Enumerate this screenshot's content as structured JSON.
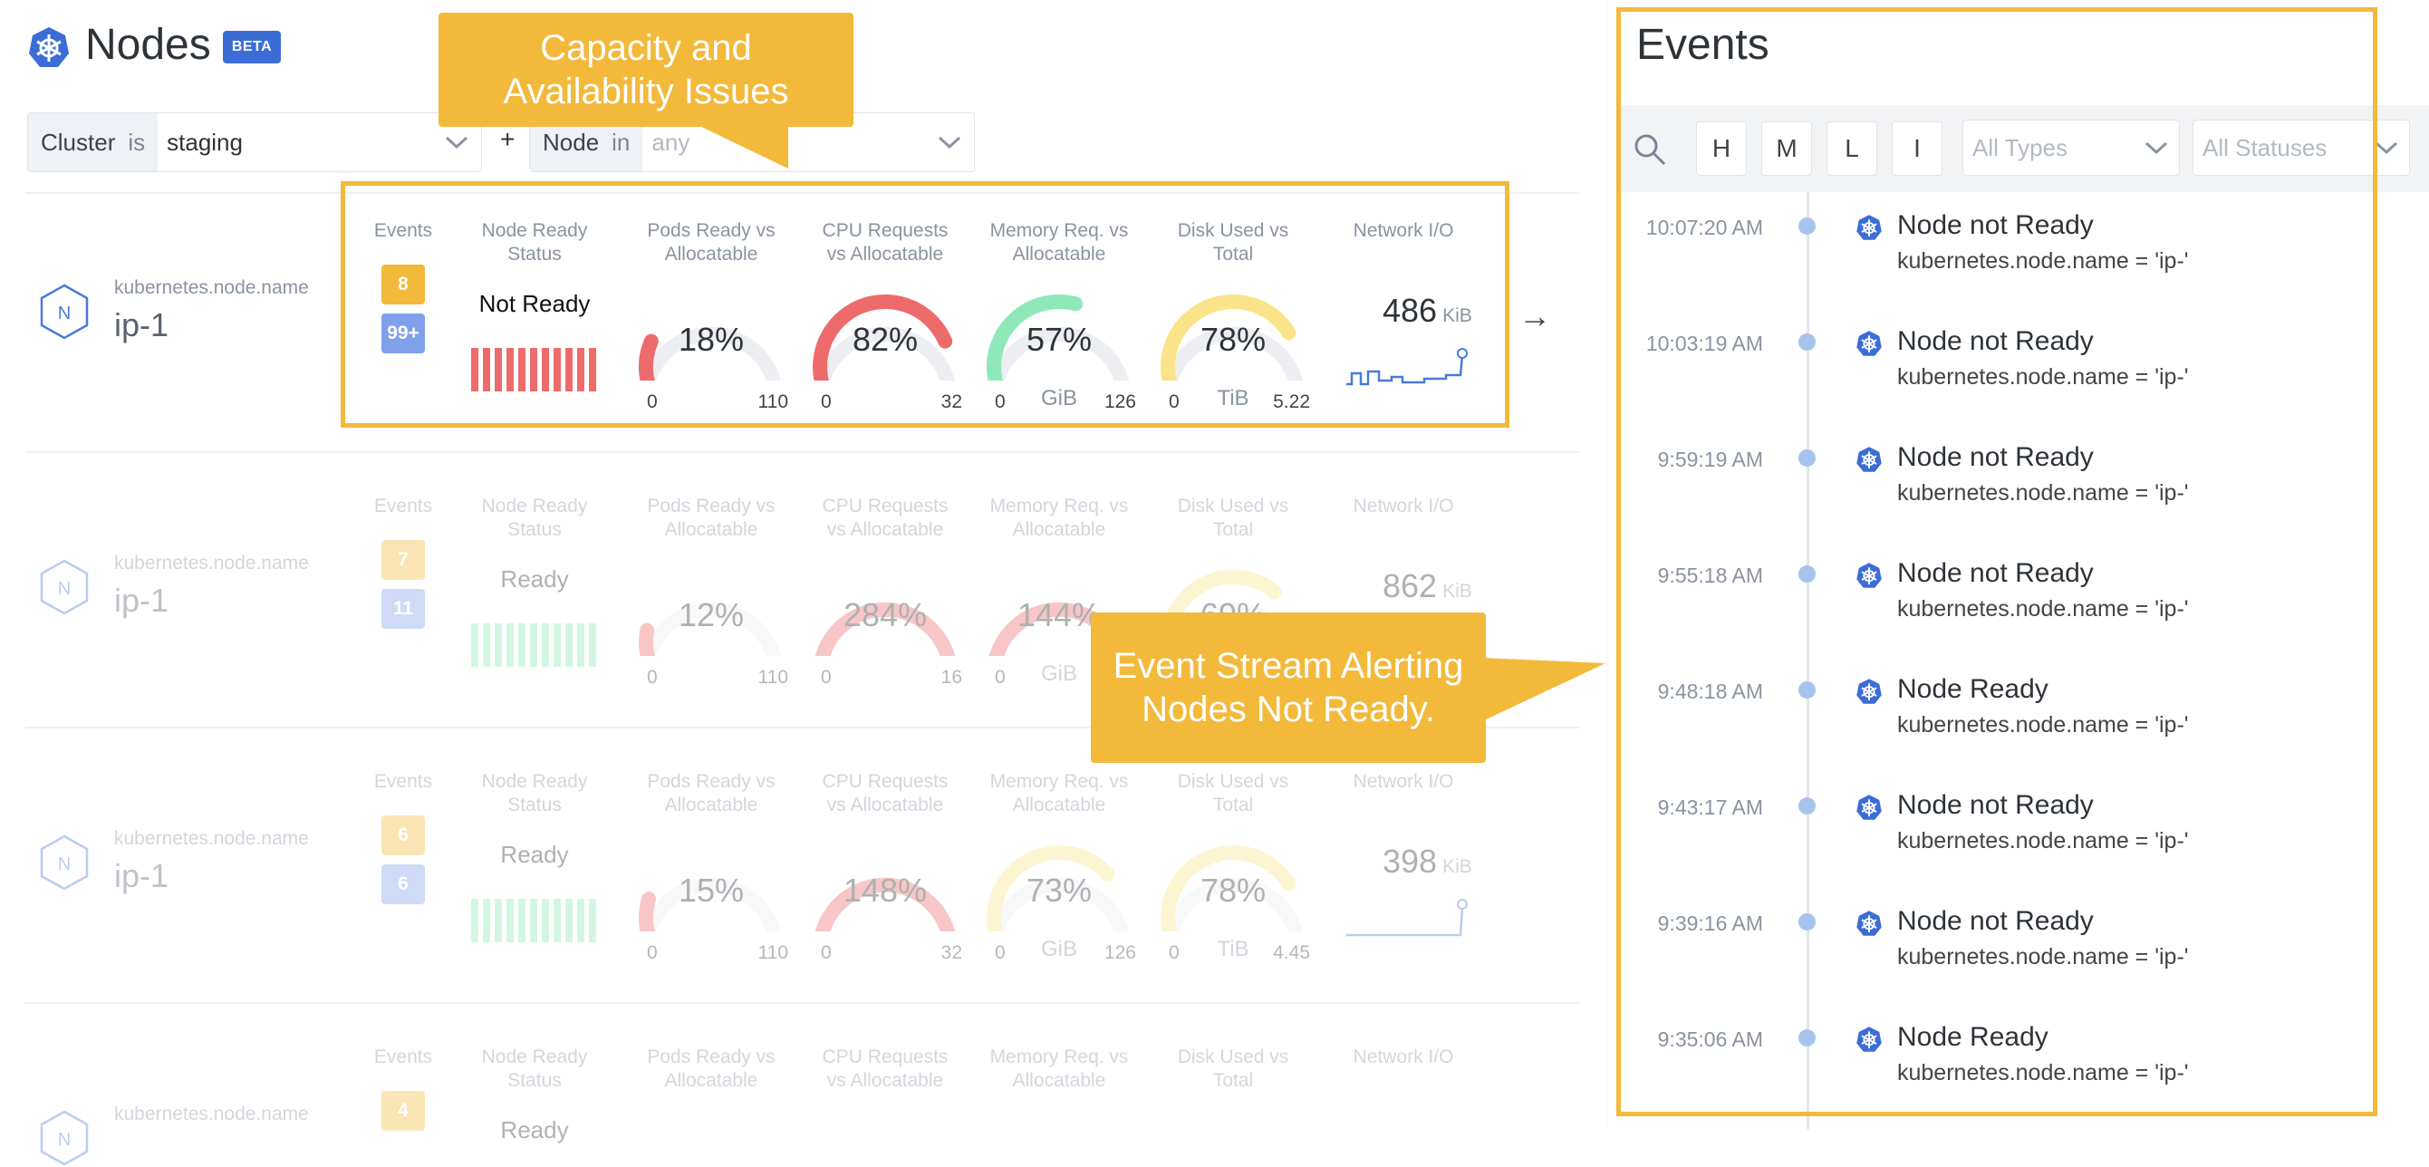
{
  "header": {
    "title": "Nodes",
    "badge": "BETA"
  },
  "filters": [
    {
      "key": "Cluster",
      "op": "is",
      "value": "staging"
    },
    {
      "key": "Node",
      "op": "in",
      "value": "any"
    }
  ],
  "filter_add": "+",
  "columns": [
    "Events",
    "Node Ready\nStatus",
    "Pods Ready vs\nAllocatable",
    "CPU Requests\nvs Allocatable",
    "Memory Req. vs\nAllocatable",
    "Disk Used vs\nTotal",
    "Network I/O"
  ],
  "nodes": [
    {
      "key": "kubernetes.node.name",
      "name": "ip-1",
      "events_a": "8",
      "events_b": "99+",
      "status": "Not Ready",
      "pods": {
        "pct": "18%",
        "min": "0",
        "max": "110",
        "frac": 0.18
      },
      "cpu": {
        "pct": "82%",
        "min": "0",
        "max": "32",
        "frac": 0.82
      },
      "mem": {
        "pct": "57%",
        "min": "0",
        "unit": "GiB",
        "max": "126",
        "frac": 0.57
      },
      "disk": {
        "pct": "78%",
        "min": "0",
        "unit": "TiB",
        "max": "5.22",
        "frac": 0.78
      },
      "net": {
        "value": "486",
        "unit": "KiB"
      }
    },
    {
      "key": "kubernetes.node.name",
      "name": "ip-1",
      "events_a": "7",
      "events_b": "11",
      "status": "Ready",
      "pods": {
        "pct": "12%",
        "min": "0",
        "max": "110",
        "frac": 0.12
      },
      "cpu": {
        "pct": "284%",
        "min": "0",
        "max": "16",
        "frac": 1.0
      },
      "mem": {
        "pct": "144%",
        "min": "0",
        "unit": "GiB",
        "max": "",
        "frac": 1.0
      },
      "disk": {
        "pct": "69%",
        "min": "",
        "unit": "",
        "max": "",
        "frac": 0.69
      },
      "net": {
        "value": "862",
        "unit": "KiB"
      }
    },
    {
      "key": "kubernetes.node.name",
      "name": "ip-1",
      "events_a": "6",
      "events_b": "6",
      "status": "Ready",
      "pods": {
        "pct": "15%",
        "min": "0",
        "max": "110",
        "frac": 0.15
      },
      "cpu": {
        "pct": "148%",
        "min": "0",
        "max": "32",
        "frac": 1.0
      },
      "mem": {
        "pct": "73%",
        "min": "0",
        "unit": "GiB",
        "max": "126",
        "frac": 0.73
      },
      "disk": {
        "pct": "78%",
        "min": "0",
        "unit": "TiB",
        "max": "4.45",
        "frac": 0.78
      },
      "net": {
        "value": "398",
        "unit": "KiB"
      }
    },
    {
      "key": "kubernetes.node.name",
      "name": "",
      "events_a": "4",
      "events_b": "",
      "status": "Ready"
    }
  ],
  "callouts": {
    "capacity": [
      "Capacity and",
      "Availability Issues"
    ],
    "stream": [
      "Event Stream Alerting",
      "Nodes Not Ready."
    ]
  },
  "events": {
    "title": "Events",
    "severities": [
      "H",
      "M",
      "L",
      "I"
    ],
    "types_placeholder": "All Types",
    "statuses_placeholder": "All Statuses",
    "items": [
      {
        "time": "10:07:20 AM",
        "name": "Node not Ready",
        "sub": "kubernetes.node.name = 'ip-'"
      },
      {
        "time": "10:03:19 AM",
        "name": "Node not Ready",
        "sub": "kubernetes.node.name = 'ip-'"
      },
      {
        "time": "9:59:19 AM",
        "name": "Node not Ready",
        "sub": "kubernetes.node.name = 'ip-'"
      },
      {
        "time": "9:55:18 AM",
        "name": "Node not Ready",
        "sub": "kubernetes.node.name = 'ip-'"
      },
      {
        "time": "9:48:18 AM",
        "name": "Node Ready",
        "sub": "kubernetes.node.name = 'ip-'"
      },
      {
        "time": "9:43:17 AM",
        "name": "Node not Ready",
        "sub": "kubernetes.node.name = 'ip-'"
      },
      {
        "time": "9:39:16 AM",
        "name": "Node not Ready",
        "sub": "kubernetes.node.name = 'ip-'"
      },
      {
        "time": "9:35:06 AM",
        "name": "Node Ready",
        "sub": "kubernetes.node.name = 'ip-'"
      }
    ]
  },
  "colors": {
    "accent": "#3c6dd6",
    "highlight": "#f2b93b",
    "red": "#ee6b6b",
    "green": "#8ee8b8",
    "yellow": "#fbe38a",
    "gauge_bg": "#eceef2"
  }
}
